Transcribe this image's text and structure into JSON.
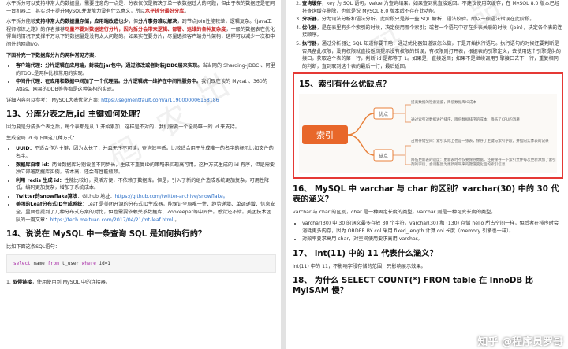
{
  "left": {
    "intro1_a": "水平拆分可以支持非常大的数据量。需要注意的一点是：分表仅仅是解决了单一表数据过大的问题，但由于表的数据还是在同一台机器上，其实对于提升MySQL并发能力没有什么意义，所以",
    "intro1_b": "水平拆分最好分库",
    "intro1_c": "。",
    "intro2_a": "水平拆分能够",
    "intro2_b": "支持非常大的数据量存储，应用端改造也少",
    "intro2_c": "，但",
    "intro2_d": "分片事务难以解决",
    "intro2_e": "，跨节点Join性能较差，逻辑复杂。《Java工程师修炼之路》的作者推荐",
    "intro2_f": "尽量不要对数据进行分片，因为拆分会带来逻辑、部署、运维的各种复杂度",
    "intro2_g": "，一般的数据表在优化得当的情况下支撑千万以下的数据量是没有太大问题的。如果实在要分片，尽量选择客户端分片架构，这样可以减少一次和中间件的网络I/O。",
    "split_title": "下面补充一下数据库分片的两种常见方案：",
    "client_a": "客户端代理：",
    "client_b": "分片逻辑在应用端，封装在jar包中，通过修改或者封装JDBC层来实现。",
    "client_c": "当当网的 Sharding-JDBC 、阿里的TDDL是两种比较常用的实现。",
    "middle_a": "中间件代理：",
    "middle_b": "在应用和数据中间加了一个代理层。分片逻辑统一维护在中间件服务中。",
    "middle_c": "我们现在谈的 Mycat 、360的Atlas、网易的DDB等等都是这种架构的实现。",
    "ref_a": "详细内容可以参考： MySQL大表优化方案: ",
    "ref_link": "https://segmentfault.com/a/1190000006158186",
    "h13": "13、分库分表之后,id 主键如何处理？",
    "p13_1": "因为要是分成多个表之后，每个表都是从 1 开始累加，这样是不对的，我们需要一个全局唯一的 id 来支持。",
    "p13_2": "生成全局 id 有下面这几种方式：",
    "uuid_a": "UUID：",
    "uuid_b": "不适合作为主键，因为太长了，并且无序不可读，查询效率低。比较适合用于生成唯一的名字的标示比如文件的名字。",
    "auto_a": "数据库自增 id：",
    "auto_b": "两台数据库分别设置不同步长，生成不重复ID的策略来实现高可用。这种方式生成的 id 有序，但是需要独立部署数据库实例，成本高，还会有性能瓶颈。",
    "redis_a": "利用 redis 生成 id：",
    "redis_b": "性能比较好，灵活方便，不依赖于数据库。但是，引入了新的组件造成系统更加复杂，可用性降低，编码更加复杂，增加了系统成本。",
    "tw_a": "Twitter的snowflake算法",
    "tw_b": "：Github 地址：",
    "tw_link": "https://github.com/twitter-archive/snowflake。",
    "leaf_a": "美团的Leaf分布式ID生成系统",
    "leaf_b": "：Leaf 是美团开源的分布式ID生成器，能保证全局唯一性、趋势递增、单调递增、信息安全，里面也提到了几种分布式方案的对比，但也需要依赖关系数据库、Zookeeper等中间件。感觉还不错。美团技术团队的一篇文章：",
    "leaf_link": "https://tech.meituan.com/2017/04/21/mt-leaf.html",
    "leaf_c": " 。",
    "h14": "14、说说在 MySQL 中一条查询 SQL 是如何执行的？",
    "p14": "比如下面这条SQL语句：",
    "code_kw1": "select",
    "code_kw2": "from",
    "code_kw3": "where",
    "code_name": "name",
    "code_tbl": "t_user",
    "code_cond": "id=1",
    "step1_a": "取得链接",
    "step1_b": "，使用使用到 MySQL 中的连接器。"
  },
  "right": {
    "r1_a": "查询缓存",
    "r1_b": "，key 为 SQL 语句，value 为查询结果，如果查到就直接返回。不建议使用次缓存，在 MySQL 8.0 版本已经将查询缓存删除，也就是说 MySQL 8.0 版本后不存在此功能。",
    "r2_a": "分析器",
    "r2_b": "，分为词法分析和语法分析。此阶段只是做一些 SQL 解析，语法校验。所以一般语法错误在此阶段。",
    "r3_a": "优化器",
    "r3_b": "，是在表里有多个索引的时候，决定使用哪个索引；或者一个语句中存在多表关联的时候（join），决定各个表的连接顺序。",
    "r4_a": "执行器",
    "r4_b": "，通过分析器让 SQL 知道你要干啥，通过优化器知道该怎么做，于是开始执行语句。执行语句的时候还要判断是否具备此权限，没有权限就直接返回提示没有权限的错误；有权限则打开表，根据表的引擎定义，去使用这个引擎提供的接口，获取这个表的第一行，判断 id 是都等于 1。如果是，直接返回；如果不是继续调用引擎接口去下一行，重复相同的判断，直到取到这个表的最后一行，最后返回。",
    "h15": "15、索引有什么优缺点？",
    "mind_root": "索引",
    "mind_adv": "优点",
    "mind_dis": "缺点",
    "adv1": "提高数据的检索速度，降低数据库IO成本",
    "adv2": "通过索引对数据进行排序，降低数据排序的成本，降低了CPU的消耗",
    "dis1": "占用存储空间：索引实际上也是一张表，保存了主键与索引字段，并指向实体表的记录",
    "dis2": "降低更新表的速度：更新表时不仅要保存数据，还要保存一下索引文件每次更新添加了索引列的字段，会调整因为更新所带来的键值变化后的索引信息",
    "h16": "16、 MySQL 中 varchar 与 char 的区别？varchar(30) 中的 30 代表的涵义？",
    "p16": "varchar 与 char 的区别，char 是一种固定长度的类型，varchar 则是一种可变长度的类型。",
    "b16_1": "varchar(30) 中 30 的涵义最多存放 30 个字符。varchar(30) 和 (130) 存储 hello 所占空间一样，但后者在排序时会消耗更多内存，因为 ORDER BY col 采用 fixed_length 计算 col 长度（memory 引擎也一样）。",
    "b16_2": "对效率要求高用 char，对空间使用要求高用 varchar。",
    "h17": "17、 int(11) 中的 11 代表什么涵义？",
    "p17": "int(11) 中的 11，不影响字段存储的范围，只影响展示效果。",
    "h18a": "18、 为什么 SELECT COUNT(",
    "h18b": ") FROM table 在 InnoDB 比",
    "h18c": "MyISAM 慢？",
    "zhihu": "知乎 @程序员罗哥"
  },
  "watermarks": [
    "码",
    "农",
    "出",
    "品"
  ]
}
